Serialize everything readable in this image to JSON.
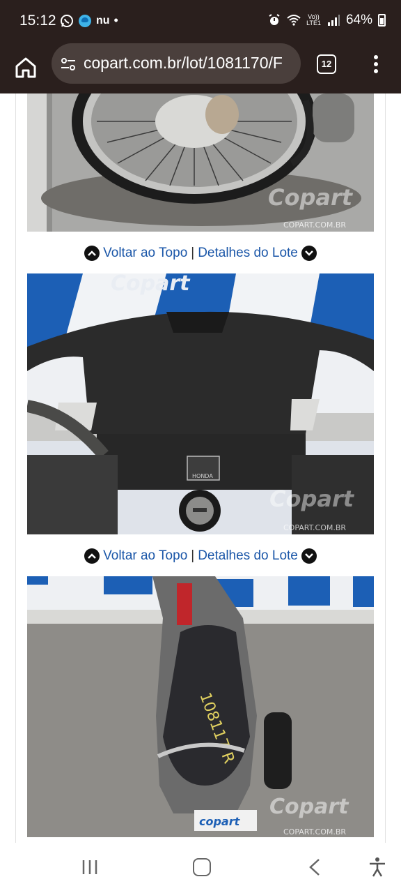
{
  "status_bar": {
    "time": "15:12",
    "left_icons": [
      "whatsapp-icon",
      "edge-browser-icon"
    ],
    "nu_label": "nu",
    "dot": "•",
    "lte_label": "Vo))\nLTE1",
    "battery_text": "64%"
  },
  "browser": {
    "url": "copart.com.br/lot/1081170/F",
    "tab_count": "12"
  },
  "lot_page": {
    "nav_links": [
      {
        "top_label": "Voltar ao Topo",
        "separator": "|",
        "details_label": "Detalhes do Lote"
      },
      {
        "top_label": "Voltar ao Topo",
        "separator": "|",
        "details_label": "Detalhes do Lote"
      }
    ],
    "photos": [
      {
        "alt": "Motorcycle front wheel and brake disc",
        "watermark": "Copart",
        "watermark_sub": "COPART.COM.BR"
      },
      {
        "alt": "Motorcycle instrument panel housing with ignition and Honda badge",
        "watermark": "Copart",
        "watermark_sub": "COPART.COM.BR",
        "badge": "HONDA"
      },
      {
        "alt": "Motorcycle seat viewed from above with lot number",
        "watermark": "Copart",
        "watermark_sub": "COPART.COM.BR",
        "seat_writing": "108117 R",
        "plate_logo": "copart"
      }
    ]
  },
  "backdrop_logo": "Copart",
  "colors": {
    "browser_chrome": "#2a1f1d",
    "link_blue": "#1a56a8",
    "copart_blue": "#1c5fb5"
  }
}
